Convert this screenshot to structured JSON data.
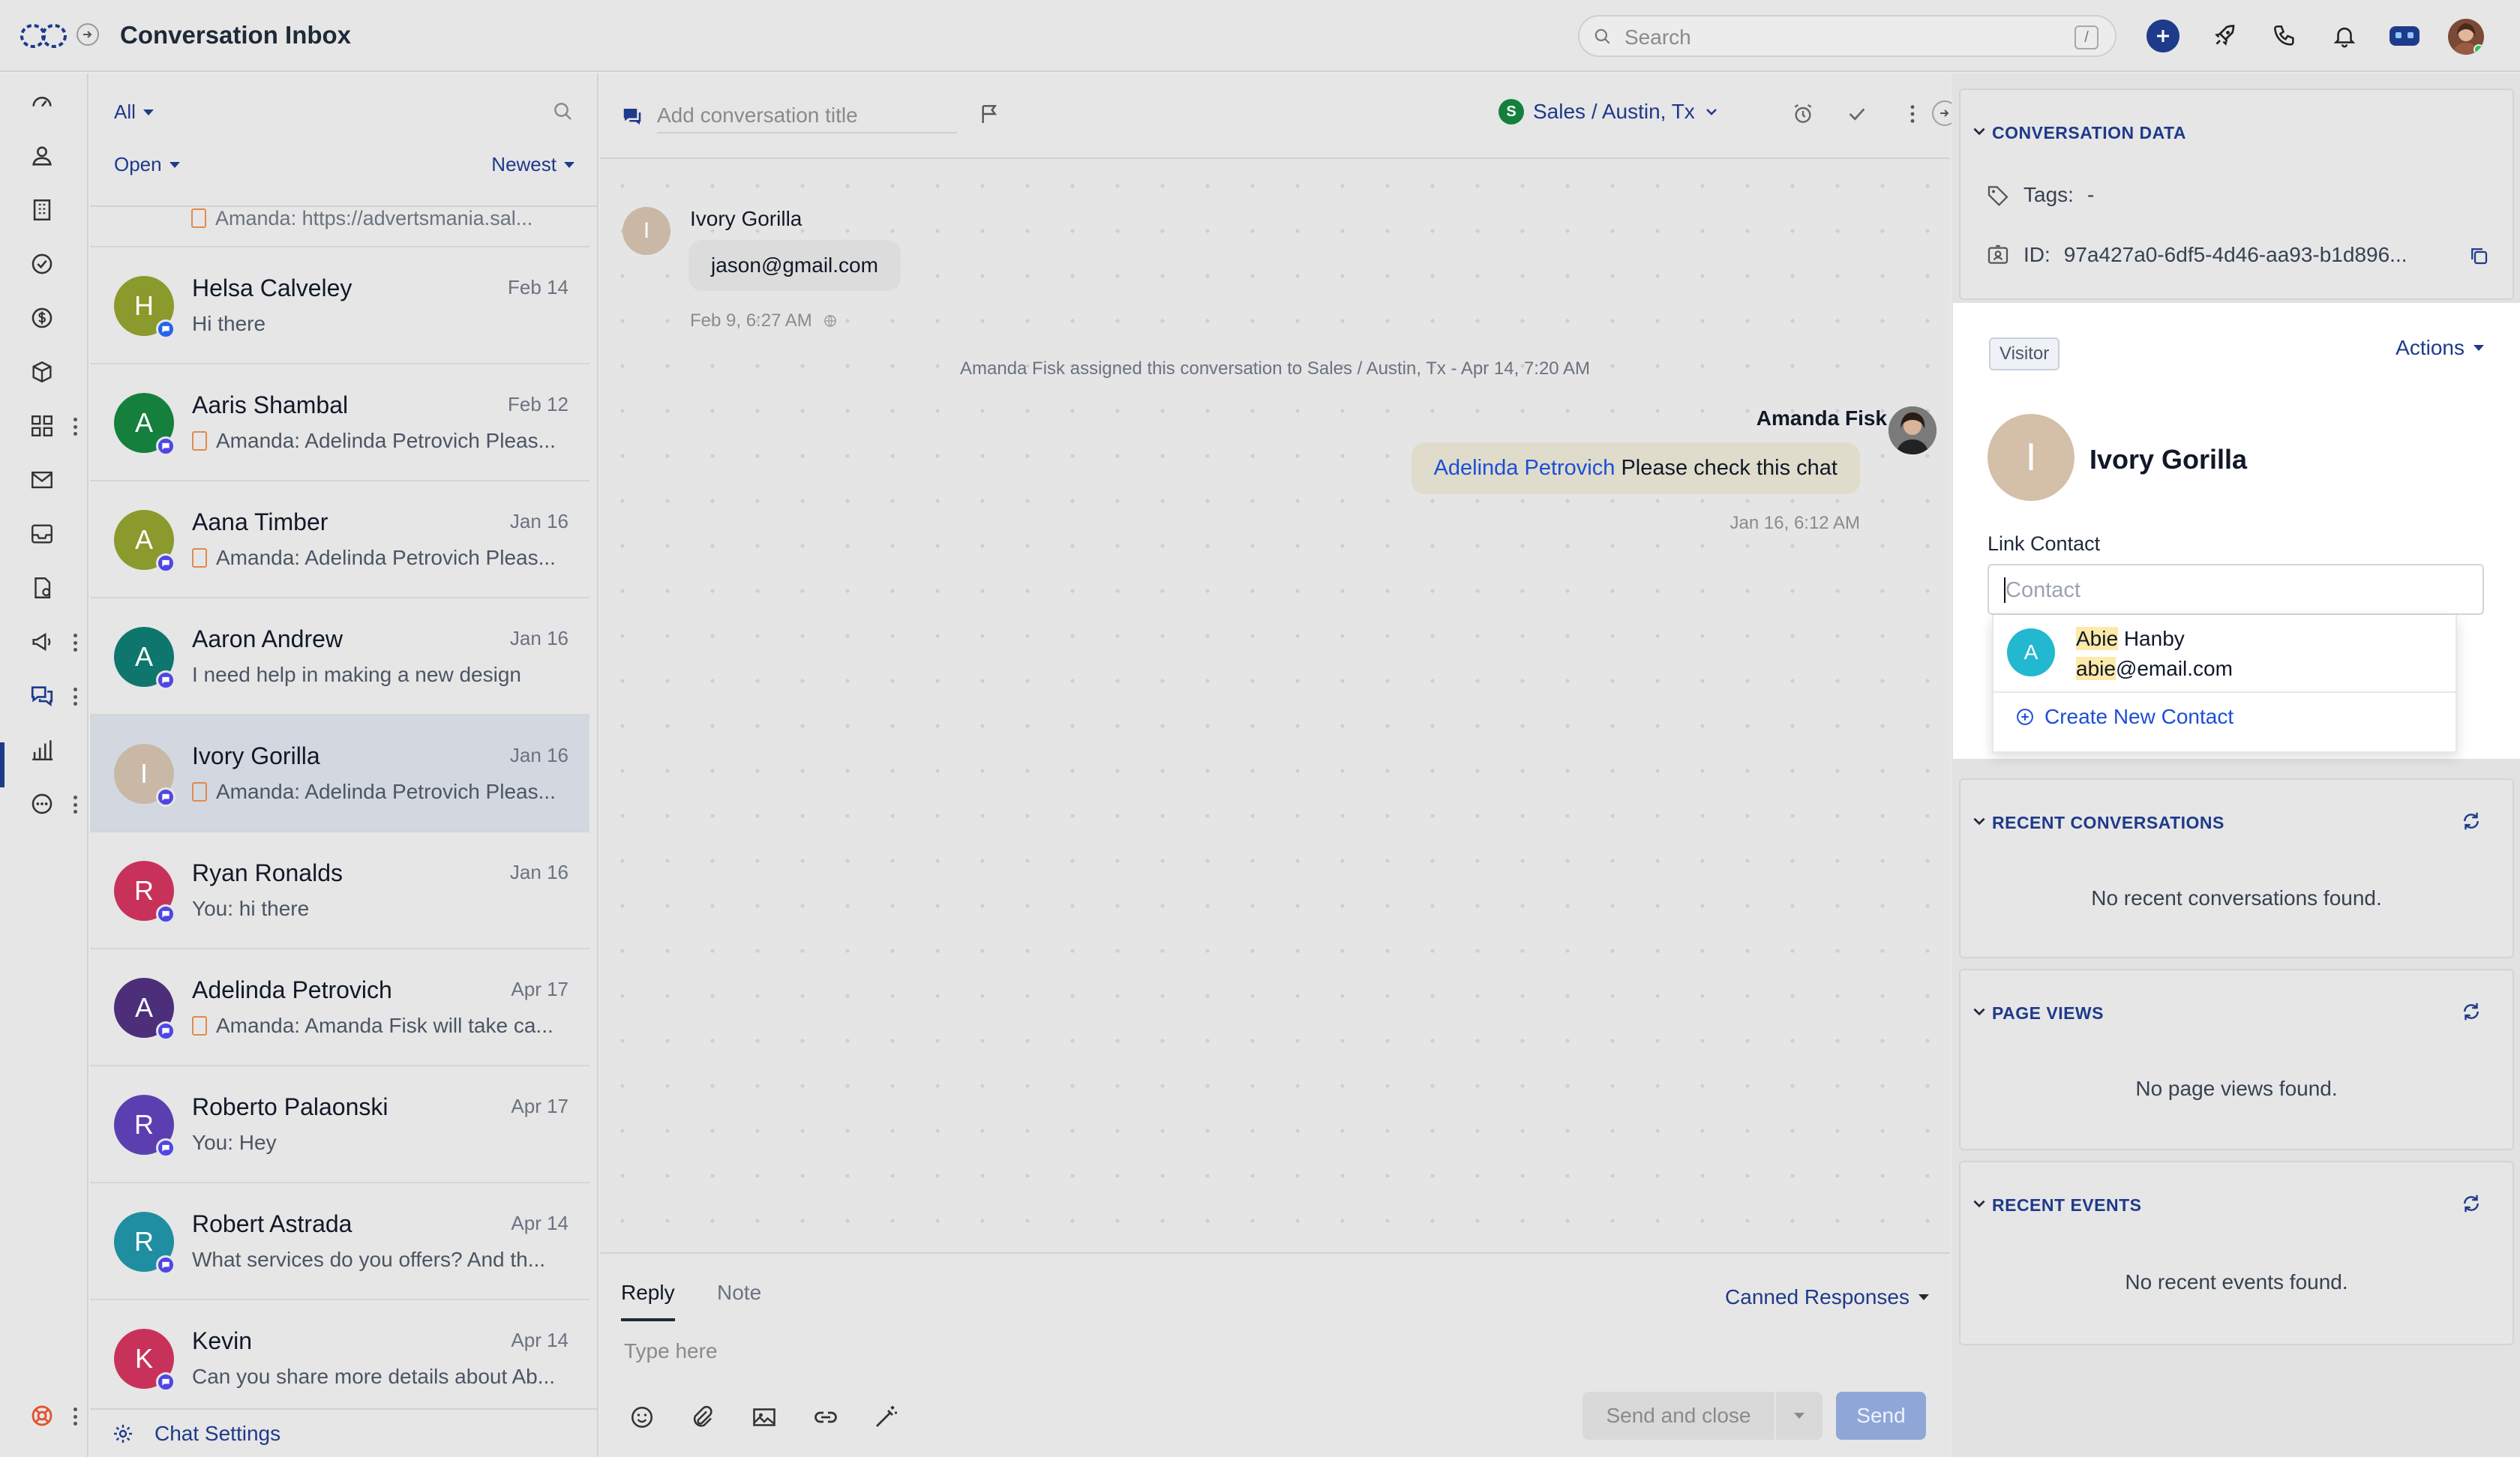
{
  "header": {
    "title": "Conversation Inbox",
    "search_placeholder": "Search",
    "search_shortcut": "/"
  },
  "list": {
    "filter_all": "All",
    "filter_status": "Open",
    "sort": "Newest",
    "top_preview": "Amanda: https://advertsmania.sal...",
    "conversations": [
      {
        "initial": "H",
        "name": "Helsa Calveley",
        "date": "Feb 14",
        "preview": "Hi there",
        "note": false,
        "color": "#8a9a2c"
      },
      {
        "initial": "A",
        "name": "Aaris Shambal",
        "date": "Feb 12",
        "preview": "Amanda: Adelinda Petrovich Pleas...",
        "note": true,
        "color": "#15803d"
      },
      {
        "initial": "A",
        "name": "Aana Timber",
        "date": "Jan 16",
        "preview": "Amanda: Adelinda Petrovich Pleas...",
        "note": true,
        "color": "#8a9a2c"
      },
      {
        "initial": "A",
        "name": "Aaron Andrew",
        "date": "Jan 16",
        "preview": "I need help in making a new design",
        "note": false,
        "color": "#0f766e"
      },
      {
        "initial": "I",
        "name": "Ivory Gorilla",
        "date": "Jan 16",
        "preview": "Amanda: Adelinda Petrovich Pleas...",
        "note": true,
        "color": "#c9b8a6"
      },
      {
        "initial": "R",
        "name": "Ryan Ronalds",
        "date": "Jan 16",
        "preview": "You: hi there",
        "note": false,
        "color": "#c8325a"
      },
      {
        "initial": "A",
        "name": "Adelinda Petrovich",
        "date": "Apr 17",
        "preview": "Amanda: Amanda Fisk will take ca...",
        "note": true,
        "color": "#4c2e7a"
      },
      {
        "initial": "R",
        "name": "Roberto Palaonski",
        "date": "Apr 17",
        "preview": "You: Hey",
        "note": false,
        "color": "#5b3fb0"
      },
      {
        "initial": "R",
        "name": "Robert Astrada",
        "date": "Apr 14",
        "preview": "What services do you offers? And th...",
        "note": false,
        "color": "#1e8ea0"
      },
      {
        "initial": "K",
        "name": "Kevin",
        "date": "Apr 14",
        "preview": "Can you share more details about Ab...",
        "note": false,
        "color": "#c8325a"
      }
    ],
    "chat_settings": "Chat Settings"
  },
  "chat": {
    "title_placeholder": "Add conversation title",
    "team": "Sales / Austin, Tx",
    "team_initial": "S",
    "visitor_initial": "I",
    "visitor_name": "Ivory Gorilla",
    "visitor_message": "jason@gmail.com",
    "visitor_time": "Feb 9, 6:27 AM",
    "system_message": "Amanda Fisk assigned this conversation to Sales / Austin, Tx - Apr 14, 7:20 AM",
    "agent_name": "Amanda Fisk",
    "agent_mention": "Adelinda Petrovich",
    "agent_message": " Please check this chat",
    "agent_time": "Jan 16, 6:12 AM"
  },
  "composer": {
    "tab_reply": "Reply",
    "tab_note": "Note",
    "canned": "Canned Responses",
    "placeholder": "Type here",
    "send_close": "Send and close",
    "send": "Send"
  },
  "panel": {
    "conversation_data": "CONVERSATION DATA",
    "tags_label": "Tags:",
    "tags_value": "-",
    "id_label": "ID:",
    "id_value": "97a427a0-6df5-4d46-aa93-b1d896...",
    "recent_conversations": "RECENT CONVERSATIONS",
    "recent_conversations_empty": "No recent conversations found.",
    "page_views": "PAGE VIEWS",
    "page_views_empty": "No page views found.",
    "recent_events": "RECENT EVENTS",
    "recent_events_empty": "No recent events found."
  },
  "visitor": {
    "badge": "Visitor",
    "actions": "Actions",
    "initial": "I",
    "name": "Ivory Gorilla",
    "link_label": "Link Contact",
    "contact_placeholder": "Contact",
    "suggestion": {
      "initial": "A",
      "name_match": "Abie",
      "name_rest": " Hanby",
      "email_match": "abie",
      "email_rest": "@email.com"
    },
    "create_new": "Create New Contact"
  }
}
